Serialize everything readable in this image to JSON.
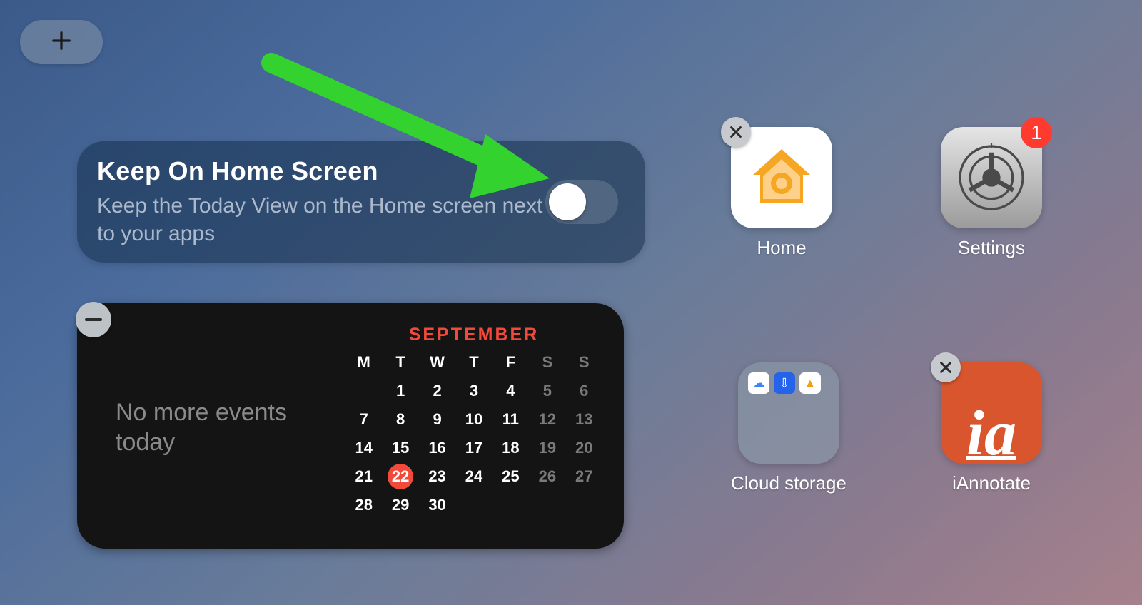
{
  "add_button": {
    "icon": "plus"
  },
  "keep_card": {
    "title": "Keep On Home Screen",
    "description": "Keep the Today View on the Home screen next to your apps",
    "toggle_on": false
  },
  "annotation_arrow": {
    "color": "#34d22e"
  },
  "calendar_widget": {
    "month": "SEPTEMBER",
    "message": "No more events today",
    "day_headers": [
      "M",
      "T",
      "W",
      "T",
      "F",
      "S",
      "S"
    ],
    "weeks": [
      [
        null,
        1,
        2,
        3,
        4,
        5,
        6
      ],
      [
        7,
        8,
        9,
        10,
        11,
        12,
        13
      ],
      [
        14,
        15,
        16,
        17,
        18,
        19,
        20
      ],
      [
        21,
        22,
        23,
        24,
        25,
        26,
        27
      ],
      [
        28,
        29,
        30,
        null,
        null,
        null,
        null
      ]
    ],
    "today": 22
  },
  "apps": {
    "home": {
      "label": "Home",
      "badge": null,
      "deletable": true
    },
    "settings": {
      "label": "Settings",
      "badge": "1",
      "deletable": false
    },
    "cloud": {
      "label": "Cloud storage",
      "badge": null,
      "deletable": false
    },
    "ia": {
      "label": "iAnnotate",
      "badge": null,
      "deletable": true
    }
  }
}
